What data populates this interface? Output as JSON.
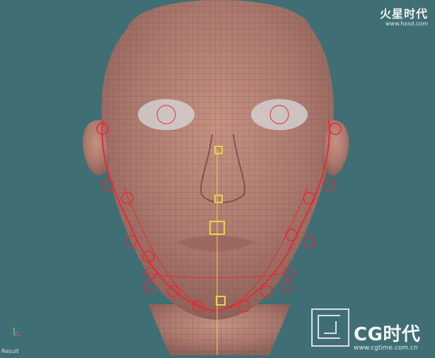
{
  "viewport": {
    "label": "Result"
  },
  "watermarks": {
    "top_brand": "火星时代",
    "top_url": "www.hxsd.com",
    "cg_title": "CG时代",
    "cg_url": "www.cgtime.com.cn"
  },
  "colors": {
    "background": "#3f6f74",
    "face": "#b88678",
    "wire": "#6b4a45",
    "rig": "#e52a35",
    "yellow": "#e7d34a"
  },
  "icons": {
    "axis": "axis-gizmo-icon",
    "logo": "cg-logo-icon"
  }
}
